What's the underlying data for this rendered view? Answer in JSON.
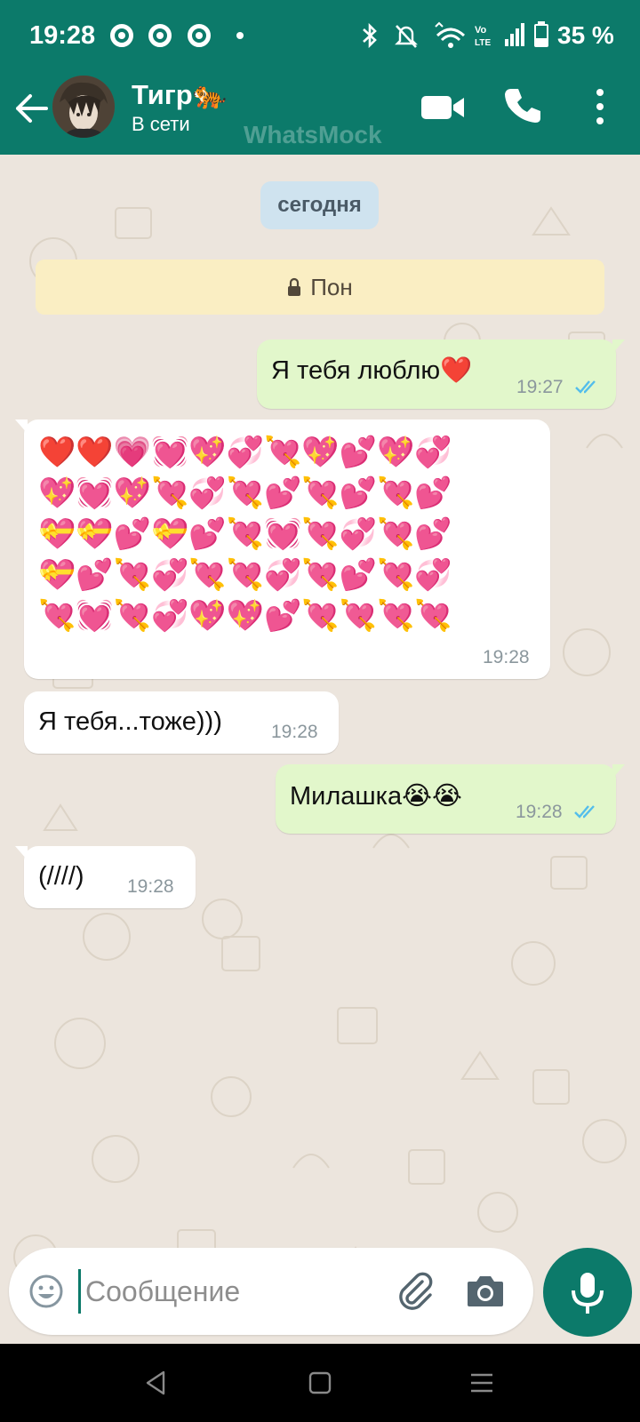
{
  "status_bar": {
    "time": "19:28",
    "battery_percent": "35 %",
    "battery_level": 0.35
  },
  "header": {
    "contact_name": "Тигр🐅",
    "contact_status": "В сети",
    "watermark": "WhatsMock"
  },
  "chat": {
    "day_chip": "сегодня",
    "encryption_banner": "Пон",
    "messages": [
      {
        "direction": "out",
        "text": "Я тебя люблю❤️",
        "time": "19:27",
        "status": "read"
      },
      {
        "direction": "in",
        "heart_rows": [
          "❤️❤️💗💓💖💞💘💖💕💖💞",
          "💖💓💖💘💞💘💕💘💕💘💕",
          "💝💝💕💝💕💘💓💘💞💘💕",
          "💝💕💘💞💘💘💞💘💕💘💞",
          "💘💓💘💞💖💖💕💘💘💘💘"
        ],
        "time": "19:28"
      },
      {
        "direction": "in",
        "text": "Я тебя...тоже)))",
        "time": "19:28"
      },
      {
        "direction": "out",
        "text": "Милашка😭😭",
        "time": "19:28",
        "status": "read"
      },
      {
        "direction": "in",
        "text": "(////)",
        "time": "19:28"
      }
    ]
  },
  "composer": {
    "placeholder": "Сообщение"
  },
  "colors": {
    "primary": "#0c7a6a",
    "outgoing_bubble": "#e2f7cb",
    "incoming_bubble": "#ffffff",
    "read_ticks": "#53bdeb"
  },
  "icons": [
    "back-arrow-icon",
    "video-call-icon",
    "phone-icon",
    "more-options-icon",
    "emoji-icon",
    "attach-icon",
    "camera-icon",
    "mic-icon",
    "lock-icon",
    "double-check-icon"
  ]
}
